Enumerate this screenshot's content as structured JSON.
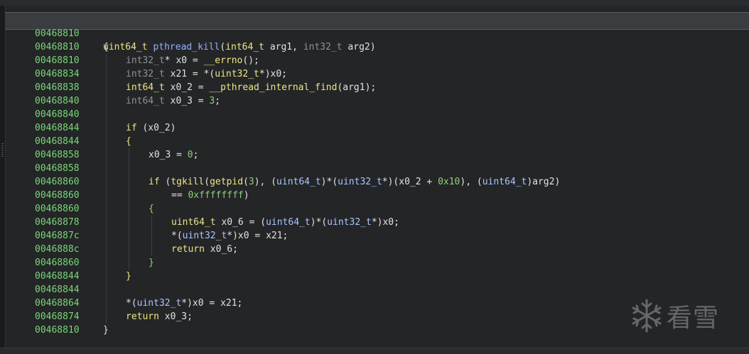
{
  "header": {
    "address": "00468810",
    "signature_tokens": [
      {
        "t": "uint64_t",
        "c": "t-type"
      },
      {
        "t": " ",
        "c": "t-op"
      },
      {
        "t": "pthread_kill",
        "c": "t-func"
      },
      {
        "t": "(",
        "c": "t-op"
      },
      {
        "t": "int64_t",
        "c": "t-type"
      },
      {
        "t": " arg1, ",
        "c": "t-op"
      },
      {
        "t": "int32_t",
        "c": "t-type-dim"
      },
      {
        "t": " arg2)",
        "c": "t-op"
      }
    ]
  },
  "lines": [
    {
      "addr": "00468810",
      "indent": 0,
      "tokens": [
        {
          "t": "{",
          "c": "t-op"
        }
      ]
    },
    {
      "addr": "00468810",
      "indent": 1,
      "tokens": [
        {
          "t": "int32_t",
          "c": "t-type-dim"
        },
        {
          "t": "* x0 = ",
          "c": "t-op"
        },
        {
          "t": "__errno",
          "c": "t-kw"
        },
        {
          "t": "();",
          "c": "t-op"
        }
      ]
    },
    {
      "addr": "00468834",
      "indent": 1,
      "tokens": [
        {
          "t": "int32_t",
          "c": "t-type-dim"
        },
        {
          "t": " x21 = *(",
          "c": "t-op"
        },
        {
          "t": "uint32_t",
          "c": "t-type"
        },
        {
          "t": "*)x0;",
          "c": "t-op"
        }
      ]
    },
    {
      "addr": "00468838",
      "indent": 1,
      "tokens": [
        {
          "t": "int64_t",
          "c": "t-type"
        },
        {
          "t": " x0_2 = ",
          "c": "t-op"
        },
        {
          "t": "__pthread_internal_find",
          "c": "t-kw"
        },
        {
          "t": "(arg1);",
          "c": "t-op"
        }
      ]
    },
    {
      "addr": "00468840",
      "indent": 1,
      "tokens": [
        {
          "t": "int64_t",
          "c": "t-type-dim"
        },
        {
          "t": " x0_3 = ",
          "c": "t-op"
        },
        {
          "t": "3",
          "c": "t-num"
        },
        {
          "t": ";",
          "c": "t-op"
        }
      ]
    },
    {
      "addr": "00468840",
      "indent": 1,
      "tokens": []
    },
    {
      "addr": "00468844",
      "indent": 1,
      "tokens": [
        {
          "t": "if",
          "c": "t-kw"
        },
        {
          "t": " (x0_2)",
          "c": "t-op"
        }
      ]
    },
    {
      "addr": "00468844",
      "indent": 1,
      "tokens": [
        {
          "t": "{",
          "c": "t-kw"
        }
      ]
    },
    {
      "addr": "00468858",
      "indent": 2,
      "tokens": [
        {
          "t": "x0_3 = ",
          "c": "t-op"
        },
        {
          "t": "0",
          "c": "t-num"
        },
        {
          "t": ";",
          "c": "t-op"
        }
      ]
    },
    {
      "addr": "00468858",
      "indent": 2,
      "tokens": []
    },
    {
      "addr": "00468860",
      "indent": 2,
      "tokens": [
        {
          "t": "if",
          "c": "t-kw"
        },
        {
          "t": " (",
          "c": "t-op"
        },
        {
          "t": "tgkill",
          "c": "t-kw"
        },
        {
          "t": "(",
          "c": "t-op"
        },
        {
          "t": "getpid",
          "c": "t-kw"
        },
        {
          "t": "(",
          "c": "t-op"
        },
        {
          "t": "3",
          "c": "t-num"
        },
        {
          "t": "), (",
          "c": "t-op"
        },
        {
          "t": "uint64_t",
          "c": "t-cast"
        },
        {
          "t": ")*(",
          "c": "t-op"
        },
        {
          "t": "uint32_t",
          "c": "t-cast"
        },
        {
          "t": "*)(x0_2 + ",
          "c": "t-op"
        },
        {
          "t": "0x10",
          "c": "t-num"
        },
        {
          "t": "), (",
          "c": "t-op"
        },
        {
          "t": "uint64_t",
          "c": "t-cast"
        },
        {
          "t": ")arg2)",
          "c": "t-op"
        }
      ]
    },
    {
      "addr": "00468860",
      "indent": 3,
      "tokens": [
        {
          "t": "== ",
          "c": "t-op"
        },
        {
          "t": "0xffffffff",
          "c": "t-num"
        },
        {
          "t": ")",
          "c": "t-op"
        }
      ]
    },
    {
      "addr": "00468860",
      "indent": 2,
      "tokens": [
        {
          "t": "{",
          "c": "t-brace"
        }
      ]
    },
    {
      "addr": "00468878",
      "indent": 3,
      "tokens": [
        {
          "t": "uint64_t",
          "c": "t-type"
        },
        {
          "t": " x0_6 = (",
          "c": "t-op"
        },
        {
          "t": "uint64_t",
          "c": "t-cast"
        },
        {
          "t": ")*(",
          "c": "t-op"
        },
        {
          "t": "uint32_t",
          "c": "t-cast"
        },
        {
          "t": "*)x0;",
          "c": "t-op"
        }
      ]
    },
    {
      "addr": "0046887c",
      "indent": 3,
      "tokens": [
        {
          "t": "*(",
          "c": "t-op"
        },
        {
          "t": "uint32_t",
          "c": "t-cast"
        },
        {
          "t": "*)x0 = x21;",
          "c": "t-op"
        }
      ]
    },
    {
      "addr": "0046888c",
      "indent": 3,
      "tokens": [
        {
          "t": "return",
          "c": "t-kw"
        },
        {
          "t": " x0_6;",
          "c": "t-op"
        }
      ]
    },
    {
      "addr": "00468860",
      "indent": 2,
      "tokens": [
        {
          "t": "}",
          "c": "t-brace"
        }
      ]
    },
    {
      "addr": "00468844",
      "indent": 1,
      "tokens": [
        {
          "t": "}",
          "c": "t-kw"
        }
      ]
    },
    {
      "addr": "00468844",
      "indent": 1,
      "tokens": []
    },
    {
      "addr": "00468864",
      "indent": 1,
      "tokens": [
        {
          "t": "*(",
          "c": "t-op"
        },
        {
          "t": "uint32_t",
          "c": "t-cast"
        },
        {
          "t": "*)x0 = x21;",
          "c": "t-op"
        }
      ]
    },
    {
      "addr": "00468874",
      "indent": 1,
      "tokens": [
        {
          "t": "return",
          "c": "t-kw"
        },
        {
          "t": " x0_3;",
          "c": "t-op"
        }
      ]
    },
    {
      "addr": "00468810",
      "indent": 0,
      "tokens": [
        {
          "t": "}",
          "c": "t-op"
        }
      ]
    }
  ],
  "watermark": {
    "text": "看雪",
    "icon": "snowflake-icon"
  }
}
